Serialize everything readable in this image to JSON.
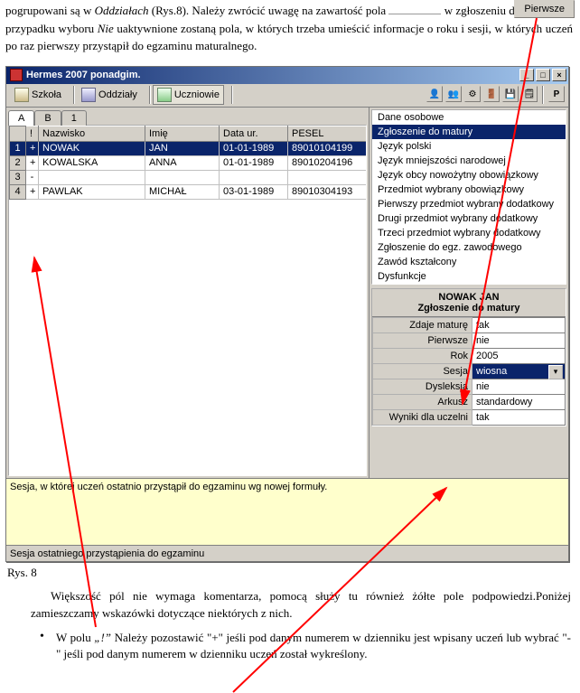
{
  "annotation_button": "Pierwsze",
  "doc_para1_pre": "pogrupowani są w ",
  "doc_para1_em1": "Oddziałach",
  "doc_para1_mid1": " (Rys.8). Należy zwrócić uwagę na zawartość pola ",
  "doc_para1_mid2": " w zgłoszeniu do matury. W przypadku wyboru ",
  "doc_para1_em2": "Nie",
  "doc_para1_tail": " uaktywnione zostaną pola, w których trzeba umieścić informacje o roku i sesji, w których uczeń po raz pierwszy przystąpił do egzaminu maturalnego.",
  "window_title": "Hermes 2007 ponadgim.",
  "toolbar": {
    "szkola": "Szkoła",
    "oddzialy": "Oddziały",
    "uczniowie": "Uczniowie",
    "p": "P"
  },
  "alpha_tabs": [
    "A",
    "B",
    "1"
  ],
  "grid_headers": {
    "mark": "!",
    "nazwisko": "Nazwisko",
    "imie": "Imię",
    "data": "Data ur.",
    "pesel": "PESEL"
  },
  "rows": [
    {
      "n": "1",
      "m": "+",
      "naz": "NOWAK",
      "imie": "JAN",
      "data": "01-01-1989",
      "pesel": "89010104199"
    },
    {
      "n": "2",
      "m": "+",
      "naz": "KOWALSKA",
      "imie": "ANNA",
      "data": "01-01-1989",
      "pesel": "89010204196"
    },
    {
      "n": "3",
      "m": "-",
      "naz": "",
      "imie": "",
      "data": "",
      "pesel": ""
    },
    {
      "n": "4",
      "m": "+",
      "naz": "PAWLAK",
      "imie": "MICHAŁ",
      "data": "03-01-1989",
      "pesel": "89010304193"
    }
  ],
  "hint": "Sesja, w której uczeń ostatnio przystąpił do egzaminu wg nowej formuły.",
  "status": "Sesja ostatniego przystąpienia do egzaminu",
  "rp_items": [
    "Dane osobowe",
    "Zgłoszenie do matury",
    "Język polski",
    "Język mniejszości narodowej",
    "Język obcy nowożytny obowiązkowy",
    "Przedmiot wybrany obowiązkowy",
    "Pierwszy przedmiot wybrany dodatkowy",
    "Drugi przedmiot wybrany dodatkowy",
    "Trzeci przedmiot wybrany dodatkowy",
    "Zgłoszenie do egz. zawodowego",
    "Zawód kształcony",
    "Dysfunkcje"
  ],
  "details_header1": "NOWAK JAN",
  "details_header2": "Zgłoszenie do matury",
  "details_rows": [
    {
      "k": "Zdaje maturę",
      "v": "tak",
      "combo": false
    },
    {
      "k": "Pierwsze",
      "v": "nie",
      "combo": false
    },
    {
      "k": "Rok",
      "v": "2005",
      "combo": false
    },
    {
      "k": "Sesja",
      "v": "wiosna",
      "combo": true
    },
    {
      "k": "Dysleksja",
      "v": "nie",
      "combo": false
    },
    {
      "k": "Arkusz",
      "v": "standardowy",
      "combo": false
    },
    {
      "k": "Wyniki dla uczelni",
      "v": "tak",
      "combo": false
    }
  ],
  "caption": "Rys. 8",
  "para2": "Większość pól nie wymaga komentarza, pomocą służy tu również żółte pole podpowiedzi.Poniżej zamieszczamy wskazówki dotyczące niektórych z nich.",
  "bullet1_a": "W polu ",
  "bullet1_em1": "„!”",
  "bullet1_b": " Należy pozostawić \"+\" jeśli pod danym numerem w dzienniku jest wpisany uczeń lub wybrać \"-\" jeśli pod danym numerem w dzienniku uczeń został wykreślony."
}
